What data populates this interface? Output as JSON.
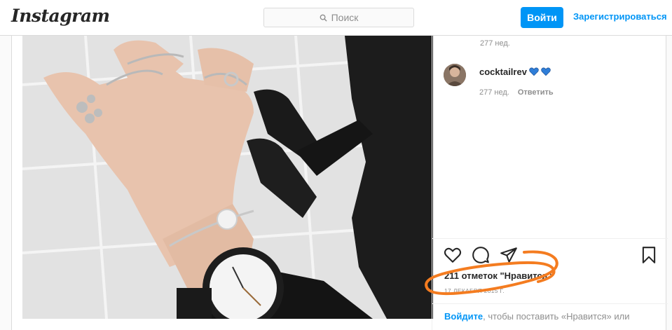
{
  "header": {
    "logo": "Instagram",
    "search_placeholder": "Поиск",
    "login_label": "Войти",
    "register_label": "Зарегистрироваться"
  },
  "comments": [
    {
      "time": "277 нед."
    },
    {
      "username": "cocktailrev",
      "time": "277 нед.",
      "reply_label": "Ответить",
      "emoji_icons": [
        "blue-heart-icon",
        "blue-heart-icon"
      ]
    }
  ],
  "post": {
    "likes_text": "211 отметок \"Нравится\"",
    "date": "17 ДЕКАБРЯ 2015 Г.",
    "login_link": "Войдите",
    "login_text": ", чтобы поставить «Нравится» или"
  },
  "colors": {
    "accent": "#0095f6",
    "annotation": "#f47c20",
    "heart_emoji": "#2f7ed8"
  }
}
